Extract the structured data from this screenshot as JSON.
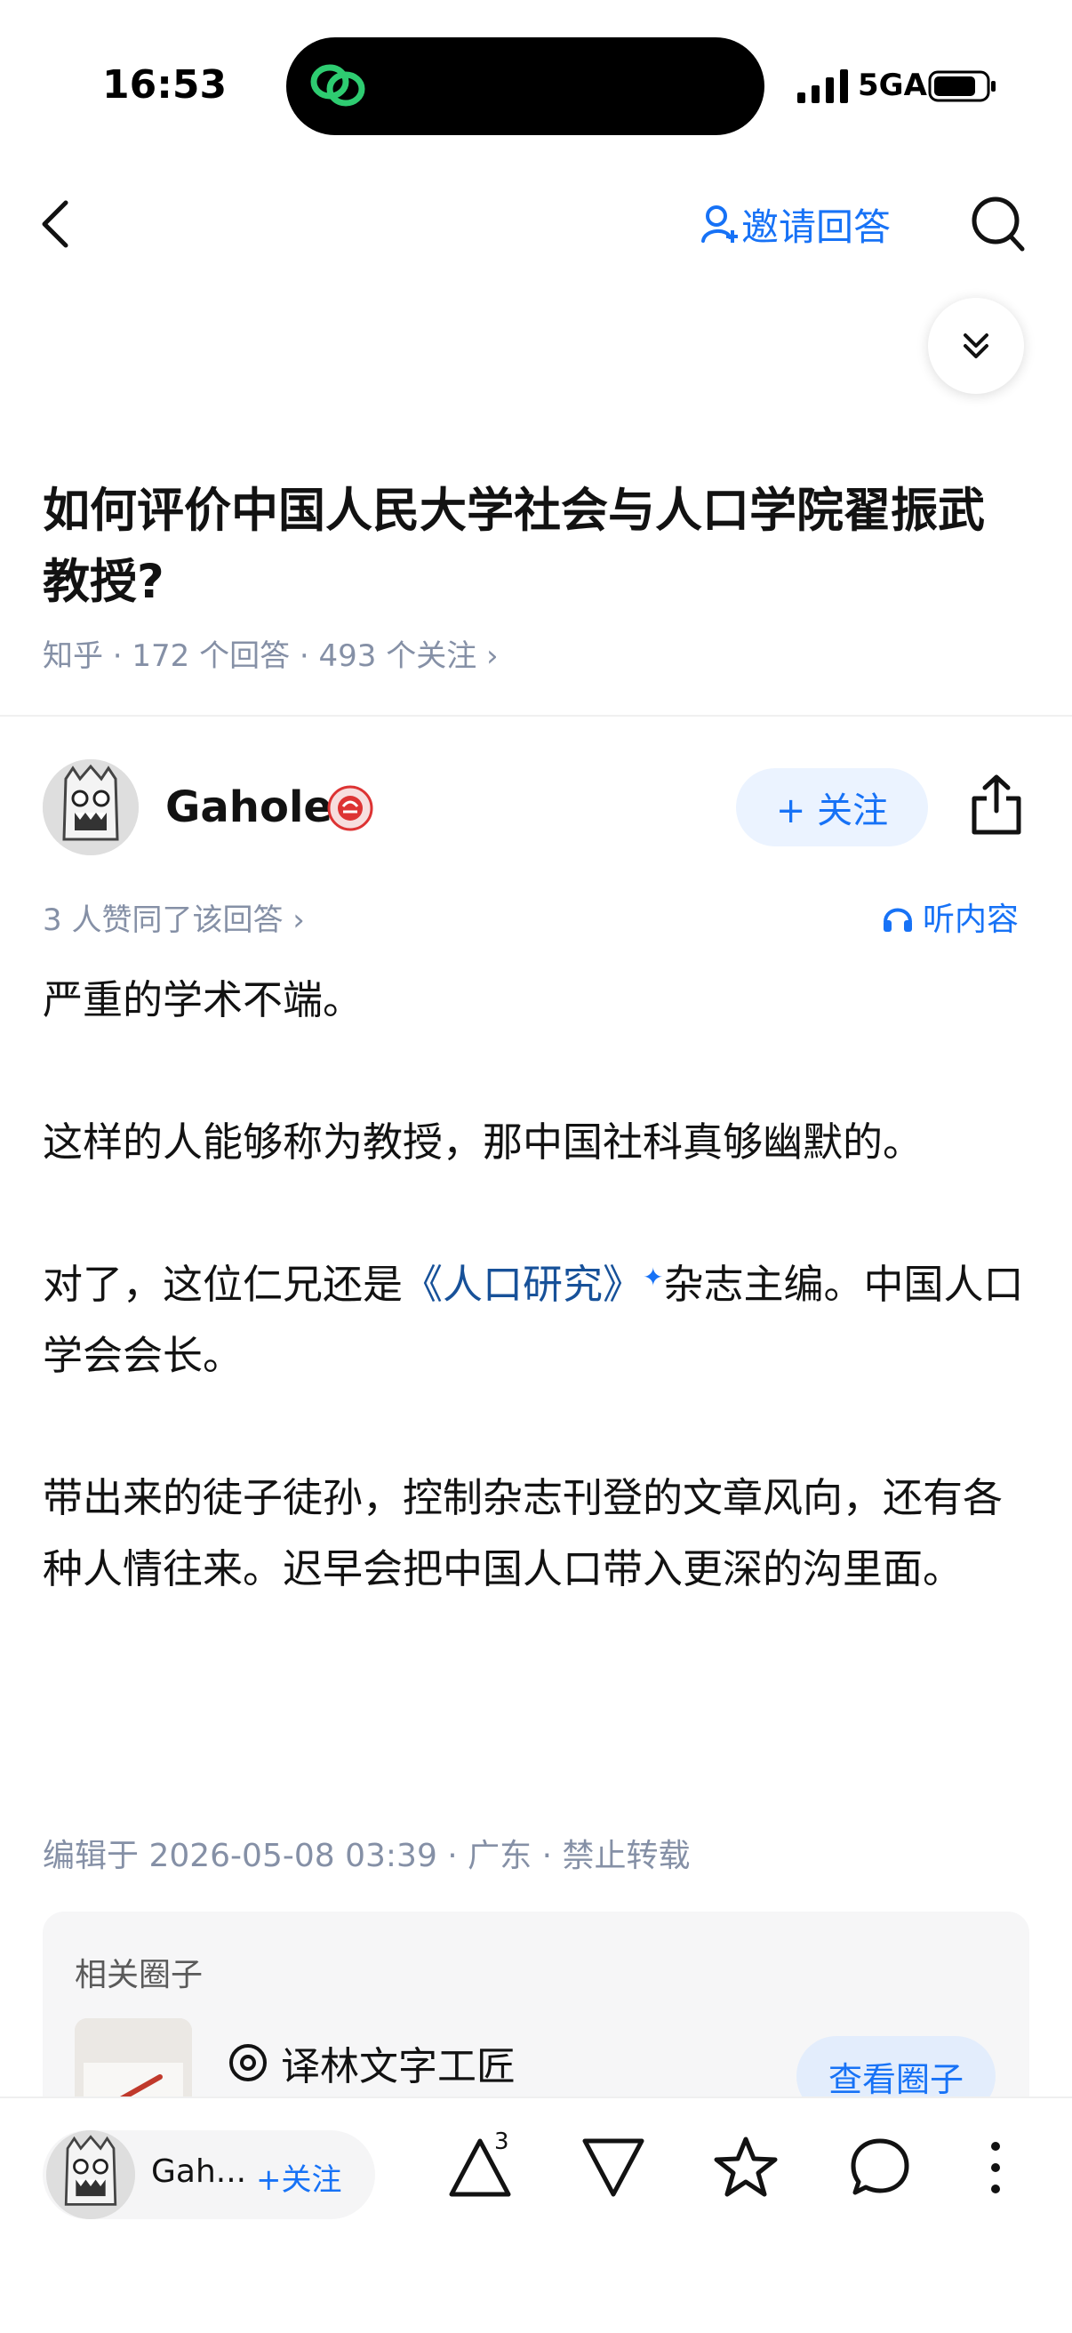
{
  "status_bar": {
    "time": "16:53",
    "network": "5GA"
  },
  "nav": {
    "invite_label": "邀请回答"
  },
  "question": {
    "title": "如何评价中国人民大学社会与人口学院翟振武教授?",
    "meta": "知乎 · 172 个回答 · 493 个关注 ›"
  },
  "answer": {
    "author": "Gahole",
    "follow_label": "+ 关注",
    "likes_text": "3 人赞同了该回答 ›",
    "listen_label": "听内容",
    "p1": "严重的学术不端。",
    "p2": "这样的人能够称为教授，那中国社科真够幽默的。",
    "p3_before": "对了，这位仁兄还是",
    "p3_link": "《人口研究》",
    "p3_sup": "✦",
    "p3_after": "杂志主编。中国人口学会会长。",
    "p4": "带出来的徒子徒孙，控制杂志刊登的文章风向，还有各种人情往来。迟早会把中国人口带入更深的沟里面。",
    "edited": "编辑于 2026-05-08 03:39 · 广东 · 禁止转载"
  },
  "related_circle": {
    "title": "相关圈子",
    "name": "译林文字工匠",
    "button": "查看圈子"
  },
  "bottom_bar": {
    "author_short": "Gah...",
    "follow_label": "+关注",
    "vote_count": "3"
  },
  "colors": {
    "accent": "#1772f6",
    "link": "#175199",
    "meta": "#8590a6"
  }
}
